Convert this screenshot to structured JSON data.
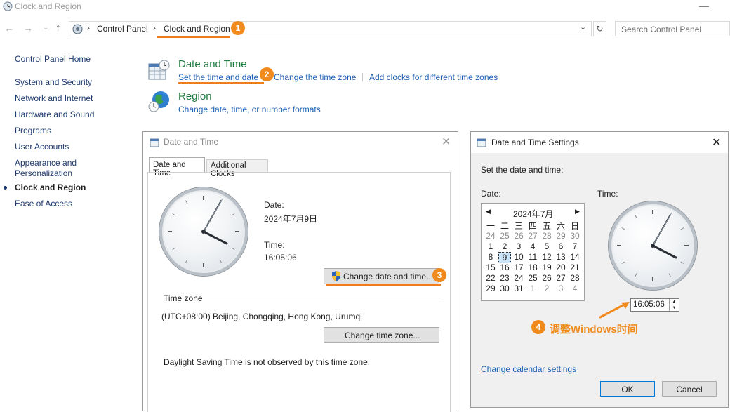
{
  "window": {
    "title": "Clock and Region"
  },
  "address": {
    "crumbs": [
      "Control Panel",
      "Clock and Region"
    ],
    "search_placeholder": "Search Control Panel"
  },
  "annotations": {
    "badge1": "1",
    "badge2": "2",
    "badge3": "3",
    "badge4": "4",
    "note4": "调整Windows时间",
    "accent_color": "#f08a1c"
  },
  "sidebar": {
    "items": [
      {
        "label": "Control Panel Home"
      },
      {
        "label": "System and Security"
      },
      {
        "label": "Network and Internet"
      },
      {
        "label": "Hardware and Sound"
      },
      {
        "label": "Programs"
      },
      {
        "label": "User Accounts"
      },
      {
        "label": "Appearance and Personalization"
      },
      {
        "label": "Clock and Region",
        "active": true
      },
      {
        "label": "Ease of Access"
      }
    ]
  },
  "categories": {
    "datetime": {
      "title": "Date and Time",
      "links": [
        "Set the time and date",
        "Change the time zone",
        "Add clocks for different time zones"
      ]
    },
    "region": {
      "title": "Region",
      "links": [
        "Change date, time, or number formats"
      ]
    }
  },
  "dt_dialog": {
    "title": "Date and Time",
    "tabs": [
      "Date and Time",
      "Additional Clocks"
    ],
    "date_label": "Date:",
    "date_value": "2024年7月9日",
    "time_label": "Time:",
    "time_value": "16:05:06",
    "change_btn": "Change date and time...",
    "tz_header": "Time zone",
    "tz_value": "(UTC+08:00) Beijing, Chongqing, Hong Kong, Urumqi",
    "change_tz_btn": "Change time zone...",
    "dst_note": "Daylight Saving Time is not observed by this time zone."
  },
  "settings_dialog": {
    "title": "Date and Time Settings",
    "instruction": "Set the date and time:",
    "date_label": "Date:",
    "time_label": "Time:",
    "month": "2024年7月",
    "weekdays": [
      "一",
      "二",
      "三",
      "四",
      "五",
      "六",
      "日"
    ],
    "weeks": [
      [
        "24",
        "25",
        "26",
        "27",
        "28",
        "29",
        "30"
      ],
      [
        "1",
        "2",
        "3",
        "4",
        "5",
        "6",
        "7"
      ],
      [
        "8",
        "9",
        "10",
        "11",
        "12",
        "13",
        "14"
      ],
      [
        "15",
        "16",
        "17",
        "18",
        "19",
        "20",
        "21"
      ],
      [
        "22",
        "23",
        "24",
        "25",
        "26",
        "27",
        "28"
      ],
      [
        "29",
        "30",
        "31",
        "1",
        "2",
        "3",
        "4"
      ]
    ],
    "selected_day": "9",
    "time_value": "16:05:06",
    "calendar_link": "Change calendar settings",
    "ok": "OK",
    "cancel": "Cancel"
  }
}
